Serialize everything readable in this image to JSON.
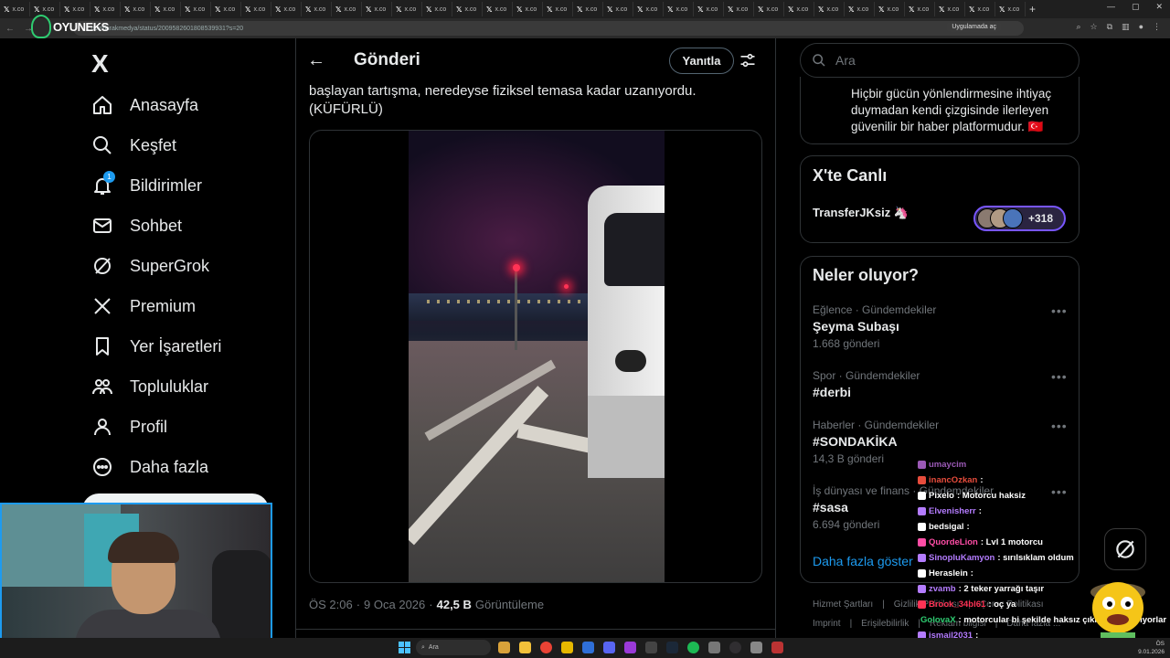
{
  "browser": {
    "tab_label": "X: x.co",
    "tab_count": 34,
    "url": "x.com/kirakmedya/status/2009582601808539931?s=20",
    "app_button": "Uygulamada aç",
    "new_tab": "+"
  },
  "overlay_logo": {
    "text": "OYUNEKS"
  },
  "nav": {
    "logo": "X",
    "items": [
      {
        "label": "Anasayfa",
        "icon": "home-icon"
      },
      {
        "label": "Keşfet",
        "icon": "search-icon"
      },
      {
        "label": "Bildirimler",
        "icon": "bell-icon",
        "badge": "1"
      },
      {
        "label": "Sohbet",
        "icon": "mail-icon"
      },
      {
        "label": "SuperGrok",
        "icon": "grok-icon"
      },
      {
        "label": "Premium",
        "icon": "x-icon"
      },
      {
        "label": "Yer İşaretleri",
        "icon": "bookmark-icon"
      },
      {
        "label": "Topluluklar",
        "icon": "communities-icon"
      },
      {
        "label": "Profil",
        "icon": "profile-icon"
      },
      {
        "label": "Daha fazla",
        "icon": "more-circle-icon"
      }
    ]
  },
  "post": {
    "header_title": "Gönderi",
    "reply_button": "Yanıtla",
    "text_line1": "başlayan tartışma, neredeyse fiziksel temasa kadar uzanıyordu.",
    "text_line2": "(KÜFÜRLÜ)",
    "time": "ÖS 2:06",
    "separator": "·",
    "date": "9 Oca 2026",
    "views_count": "42,5 B",
    "views_label": "Görüntüleme"
  },
  "right": {
    "search_placeholder": "Ara",
    "about_text": "Hiçbir gücün yönlendirmesine ihtiyaç duymadan kendi çizgisinde ilerleyen güvenilir bir haber platformudur. 🇹🇷",
    "live_title": "X'te Canlı",
    "live_user": "TransferJKsiz 🦄",
    "live_count": "+318",
    "trends_title": "Neler oluyor?",
    "trends": [
      {
        "meta": "Eğlence · Gündemdekiler",
        "name": "Şeyma Subaşı",
        "count": "1.668 gönderi"
      },
      {
        "meta": "Spor · Gündemdekiler",
        "name": "#derbi",
        "count": ""
      },
      {
        "meta": "Haberler · Gündemdekiler",
        "name": "#SONDAKİKA",
        "count": "14,3 B gönderi"
      },
      {
        "meta": "İş dünyası ve finans · Gündemdekiler",
        "name": "#sasa",
        "count": "6.694 gönderi"
      }
    ],
    "show_more": "Daha fazla göster",
    "footer_row1": [
      "Hizmet Şartları",
      "|",
      "Gizlilik Politikası",
      "|",
      "Çerez Politikası"
    ],
    "footer_row2": [
      "Imprint",
      "|",
      "Erişilebilirlik",
      "|",
      "Reklam bilgisi",
      "|",
      "Daha fazla ..."
    ]
  },
  "chat": [
    {
      "user": "umaycim",
      "msg": "",
      "color": "#9b59b6"
    },
    {
      "user": "inancOzkan",
      "msg": ":",
      "color": "#e74c3c"
    },
    {
      "user": "Pixelo",
      "msg": ": Motorcu haksiz",
      "color": "#ffffff"
    },
    {
      "user": "Elvenisherr",
      "msg": ":",
      "color": "#b47cff"
    },
    {
      "user": "bedsigal",
      "msg": ":",
      "color": "#ffffff"
    },
    {
      "user": "QuordeLion",
      "msg": ": Lvl 1 motorcu",
      "color": "#ff4da6"
    },
    {
      "user": "SinopluKamyon",
      "msg": ": sırılsıklam oldum",
      "color": "#b47cff"
    },
    {
      "user": "Heraslein",
      "msg": ":",
      "color": "#ffffff"
    },
    {
      "user": "zvamb",
      "msg": ": 2 teker yarrağı taşır",
      "color": "#b47cff"
    },
    {
      "user": "Brook_34bl61",
      "msg": ": oç ya",
      "color": "#ff3355"
    },
    {
      "user": "GolovaX",
      "msg": ": motorcular bi şekilde haksız çıkmayı başarıyorlar",
      "color": "#2ecc71"
    },
    {
      "user": "ismail2031",
      "msg": ":",
      "color": "#b47cff"
    }
  ],
  "taskbar": {
    "search": "Ara",
    "clock_line1": "ÖS",
    "clock_line2": "9.01.2026"
  },
  "colors": {
    "accent": "#1d9bf0",
    "border": "#2f3336",
    "live_ring": "#7856ff"
  }
}
